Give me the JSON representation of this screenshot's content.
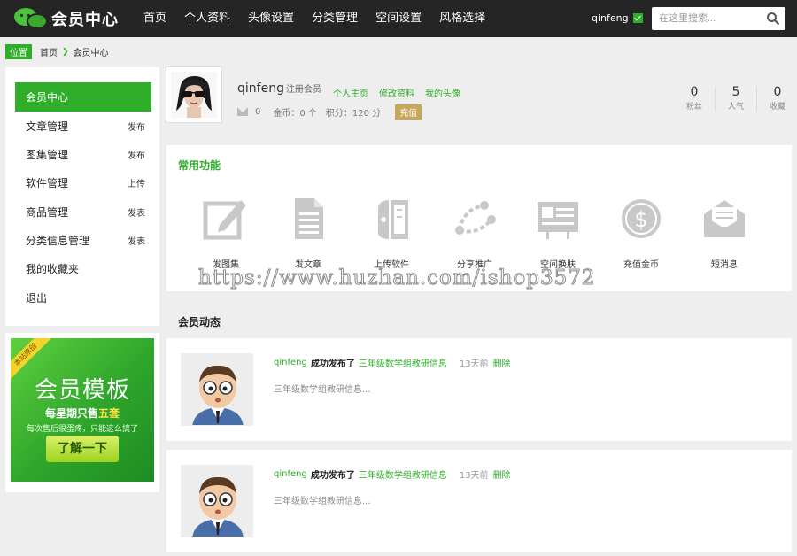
{
  "header": {
    "logo_text": "会员中心",
    "nav": [
      "首页",
      "个人资料",
      "头像设置",
      "分类管理",
      "空间设置",
      "风格选择"
    ],
    "username": "qinfeng",
    "search_placeholder": "在这里搜索..."
  },
  "breadcrumb": {
    "tag": "位置",
    "home": "首页",
    "current": "会员中心"
  },
  "sidebar": {
    "items": [
      {
        "label": "会员中心",
        "action": ""
      },
      {
        "label": "文章管理",
        "action": "发布"
      },
      {
        "label": "图集管理",
        "action": "发布"
      },
      {
        "label": "软件管理",
        "action": "上传"
      },
      {
        "label": "商品管理",
        "action": "发表"
      },
      {
        "label": "分类信息管理",
        "action": "发表"
      },
      {
        "label": "我的收藏夹",
        "action": ""
      },
      {
        "label": "退出",
        "action": ""
      }
    ]
  },
  "banner": {
    "ribbon": "本站原创",
    "title": "会员模板",
    "sub_prefix": "每星期只售",
    "sub_highlight": "五套",
    "line": "每次售后很蛋疼，只能这么搞了",
    "button": "了解一下"
  },
  "profile": {
    "name": "qinfeng",
    "role": "注册会员",
    "links": [
      "个人主页",
      "修改资料",
      "我的头像"
    ],
    "messages": "0",
    "coins": "金币：0 个",
    "points": "积分：120 分",
    "recharge": "充值",
    "stats": [
      {
        "value": "0",
        "label": "粉丝"
      },
      {
        "value": "5",
        "label": "人气"
      },
      {
        "value": "0",
        "label": "收藏"
      }
    ]
  },
  "functions": {
    "title": "常用功能",
    "items": [
      {
        "label": "发图集",
        "icon": "edit-icon"
      },
      {
        "label": "发文章",
        "icon": "document-icon"
      },
      {
        "label": "上传软件",
        "icon": "software-icon"
      },
      {
        "label": "分享推广",
        "icon": "share-icon"
      },
      {
        "label": "空间换肤",
        "icon": "skin-icon"
      },
      {
        "label": "充值金币",
        "icon": "coin-icon"
      },
      {
        "label": "短消息",
        "icon": "message-icon"
      }
    ]
  },
  "watermark": "https://www.huzhan.com/ishop3572",
  "activity": {
    "title": "会员动态",
    "items": [
      {
        "user": "qinfeng",
        "verb": "成功发布了",
        "target": "三年级数学组教研信息",
        "time": "13天前",
        "delete": "删除",
        "desc": "三年级数学组教研信息..."
      },
      {
        "user": "qinfeng",
        "verb": "成功发布了",
        "target": "三年级数学组教研信息",
        "time": "13天前",
        "delete": "删除",
        "desc": "三年级数学组教研信息..."
      }
    ]
  },
  "colors": {
    "accent": "#2fae2a",
    "topbar": "#252525",
    "recharge": "#c7a85a"
  }
}
